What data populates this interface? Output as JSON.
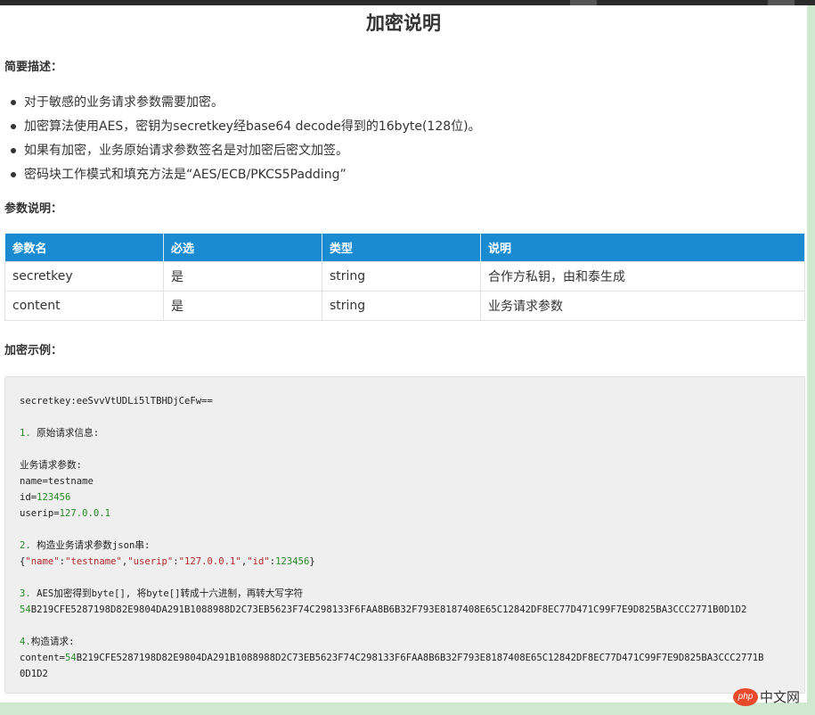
{
  "title": "加密说明",
  "summary_heading": "简要描述：",
  "summary_items": [
    "对于敏感的业务请求参数需要加密。",
    "加密算法使用AES，密钥为secretkey经base64 decode得到的16byte(128位)。",
    "如果有加密，业务原始请求参数签名是对加密后密文加签。",
    "密码块工作模式和填充方法是“AES/ECB/PKCS5Padding”"
  ],
  "params_heading": "参数说明：",
  "params_table": {
    "headers": [
      "参数名",
      "必选",
      "类型",
      "说明"
    ],
    "rows": [
      [
        "secretkey",
        "是",
        "string",
        "合作方私钥，由和泰生成"
      ],
      [
        "content",
        "是",
        "string",
        "业务请求参数"
      ]
    ]
  },
  "example_heading": "加密示例：",
  "code": {
    "line01": "secretkey:eeSvvVtUDLi5lTBHDjCeFw==",
    "line02_num": "1.",
    "line02_text": " 原始请求信息:",
    "line03": "业务请求参数:",
    "line04": "name=testname",
    "line05_key": "id=",
    "line05_val": "123456",
    "line06_key": "userip=",
    "line06_val": "127.0.0.1",
    "line07_num": "2.",
    "line07_text": " 构造业务请求参数json串:",
    "line08_open": "{",
    "line08_k1": "\"name\"",
    "line08_v1": "\"testname\"",
    "line08_k2": "\"userip\"",
    "line08_v2": "\"127.0.0.1\"",
    "line08_k3": "\"id\"",
    "line08_v3": "123456",
    "line08_close": "}",
    "line09_num": "3.",
    "line09_text": " AES加密得到byte[], 将byte[]转成十六进制，再转大写字符",
    "line10_num": "54",
    "line10_text": "B219CFE5287198D82E9804DA291B1088988D2C73EB5623F74C298133F6FAA8B6B32F793E8187408E65C12842DF8EC77D471C99F7E9D825BA3CCC2771B0D1D2",
    "line11_num": "4.",
    "line11_text": "构造请求:",
    "line12_key": "content=",
    "line12_num": "54",
    "line12_text": "B219CFE5287198D82E9804DA291B1088988D2C73EB5623F74C298133F6FAA8B6B32F793E8187408E65C12842DF8EC77D471C99F7E9D825BA3CCC2771B",
    "line13": "0D1D2"
  },
  "watermark": {
    "php": "php",
    "cn": "中文网"
  },
  "colors": {
    "table_header": "#1a8bd1",
    "code_bg": "#efefef",
    "number": "#2a8a2a",
    "string": "#b2282b",
    "page_bg": "#cfe8cf"
  }
}
